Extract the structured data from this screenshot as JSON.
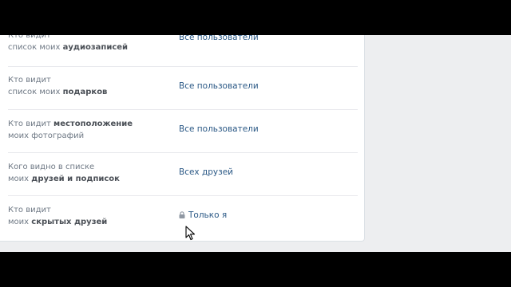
{
  "privacy": {
    "rows": [
      {
        "line1": "Кто видит",
        "line2_plain": "список моих ",
        "line2_bold": "аудиозаписей",
        "value": "Все пользователи"
      },
      {
        "line1": "Кто видит",
        "line2_plain": "список моих ",
        "line2_bold": "подарков",
        "value": "Все пользователи"
      },
      {
        "line1_plain": "Кто видит ",
        "line1_bold": "местоположение",
        "line2": "моих фотографий",
        "value": "Все пользователи"
      },
      {
        "line1": "Кого видно в списке",
        "line2_plain": "моих ",
        "line2_bold": "друзей и подписок",
        "value": "Всех друзей"
      },
      {
        "line1": "Кто видит",
        "line2_plain": "моих ",
        "line2_bold": "скрытых друзей",
        "value": "Только я",
        "value_icon": "lock-icon"
      }
    ]
  },
  "colors": {
    "link": "#2a5885",
    "label": "#6f7985",
    "page_background": "#edeef0",
    "panel_background": "#ffffff"
  }
}
